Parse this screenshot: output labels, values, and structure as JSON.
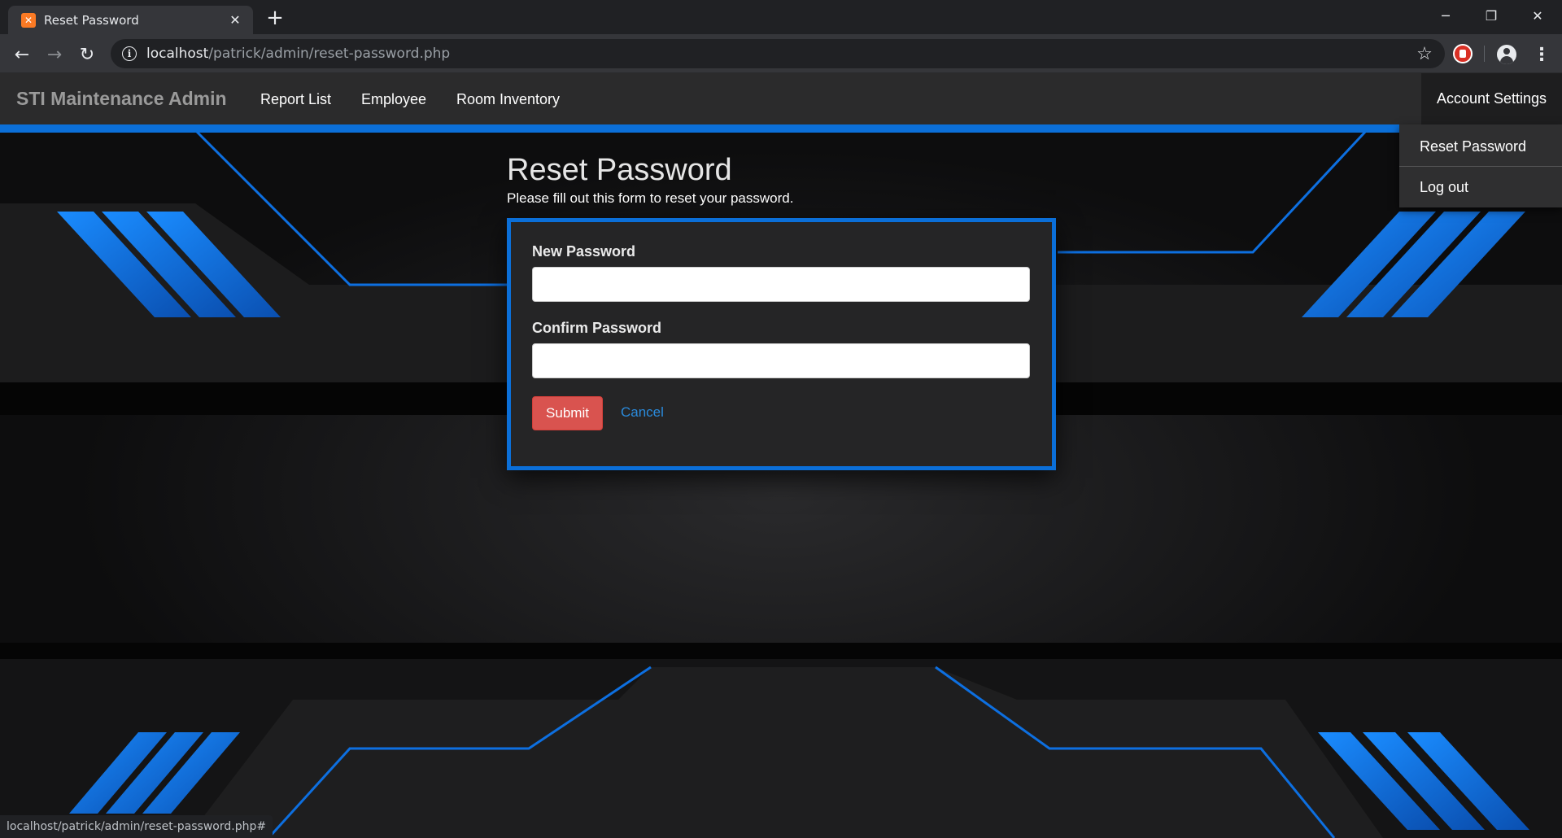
{
  "browser": {
    "tab_title": "Reset Password",
    "tab_favicon": "xampp-icon",
    "url_host": "localhost",
    "url_path": "/patrick/admin/reset-password.php",
    "status_url": "localhost/patrick/admin/reset-password.php#"
  },
  "navbar": {
    "brand": "STI Maintenance Admin",
    "links": [
      "Report List",
      "Employee",
      "Room Inventory"
    ],
    "account": "Account Settings",
    "accent_color": "#0b6fd8"
  },
  "dropdown": {
    "items": [
      "Reset Password",
      "Log out"
    ]
  },
  "page": {
    "title": "Reset Password",
    "subtitle": "Please fill out this form to reset your password."
  },
  "form": {
    "new_password_label": "New Password",
    "new_password_value": "",
    "confirm_password_label": "Confirm Password",
    "confirm_password_value": "",
    "submit_label": "Submit",
    "cancel_label": "Cancel",
    "submit_color": "#d9534f"
  }
}
